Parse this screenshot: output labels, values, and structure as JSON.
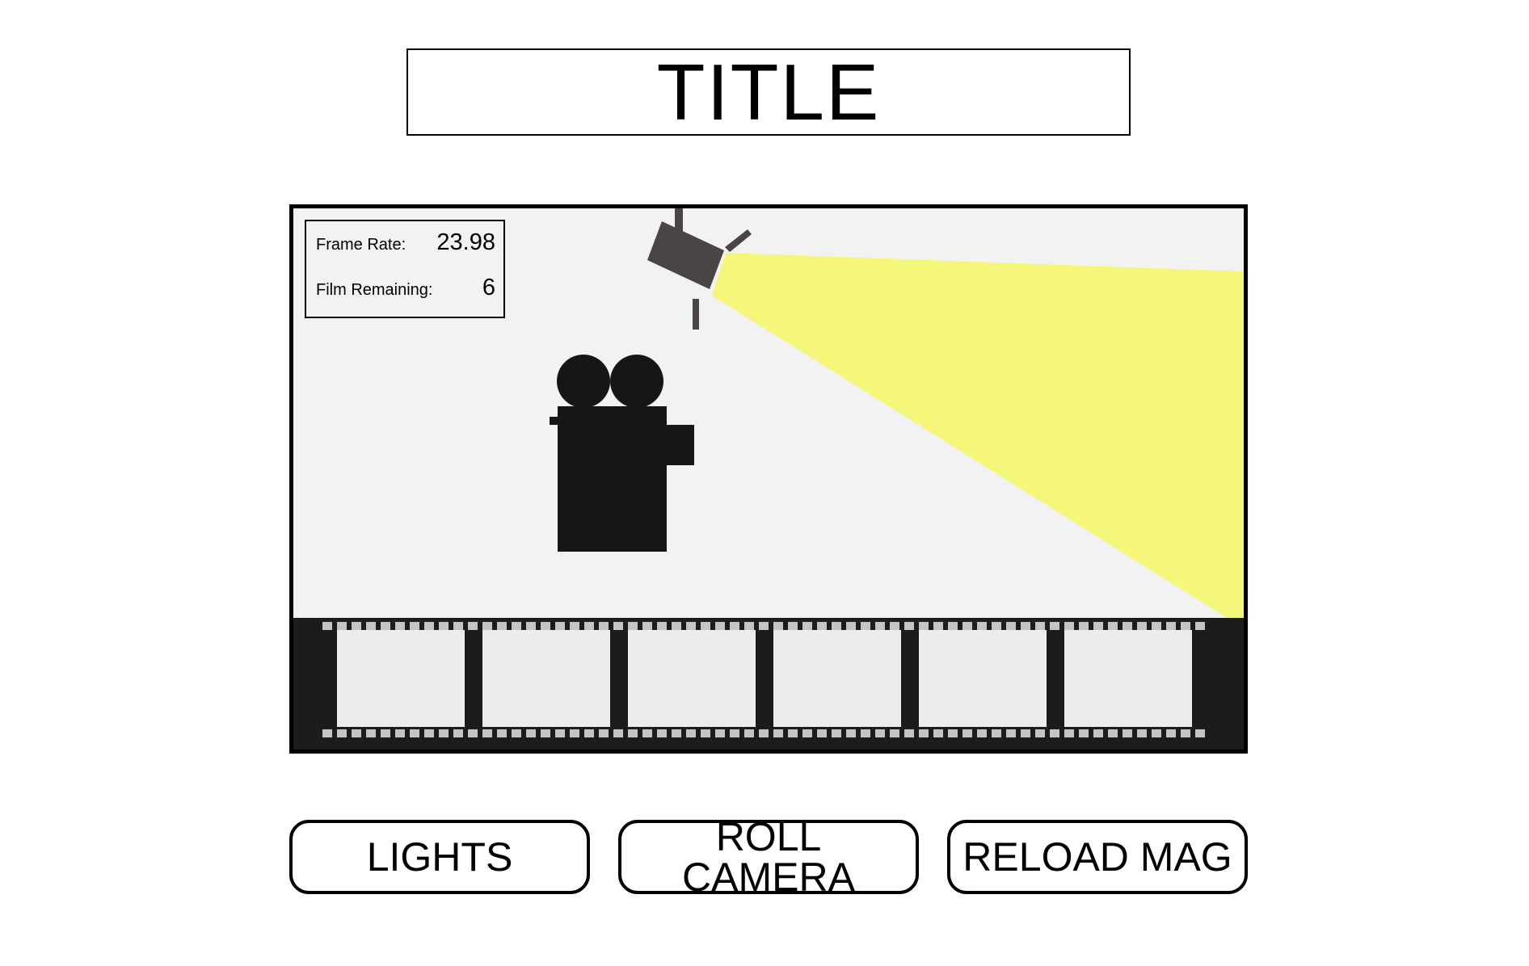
{
  "title": "TITLE",
  "info": {
    "frame_rate_label": "Frame Rate:",
    "frame_rate_value": "23.98",
    "film_remaining_label": "Film Remaining:",
    "film_remaining_value": "6"
  },
  "buttons": {
    "lights": "LIGHTS",
    "roll_camera": "ROLL CAMERA",
    "reload_mag": "RELOAD MAG"
  },
  "scene": {
    "frame_count": 6,
    "icons": [
      "spotlight-icon",
      "light-beam",
      "film-camera-icon",
      "film-strip"
    ],
    "colors": {
      "stage_background": "#f2f2f2",
      "light_beam": "#f5f77a",
      "spotlight": "#4a4444",
      "camera": "#161616",
      "film_strip": "#1c1c1c",
      "film_frame": "#edecea",
      "sprocket": "#c4c4c4"
    }
  }
}
